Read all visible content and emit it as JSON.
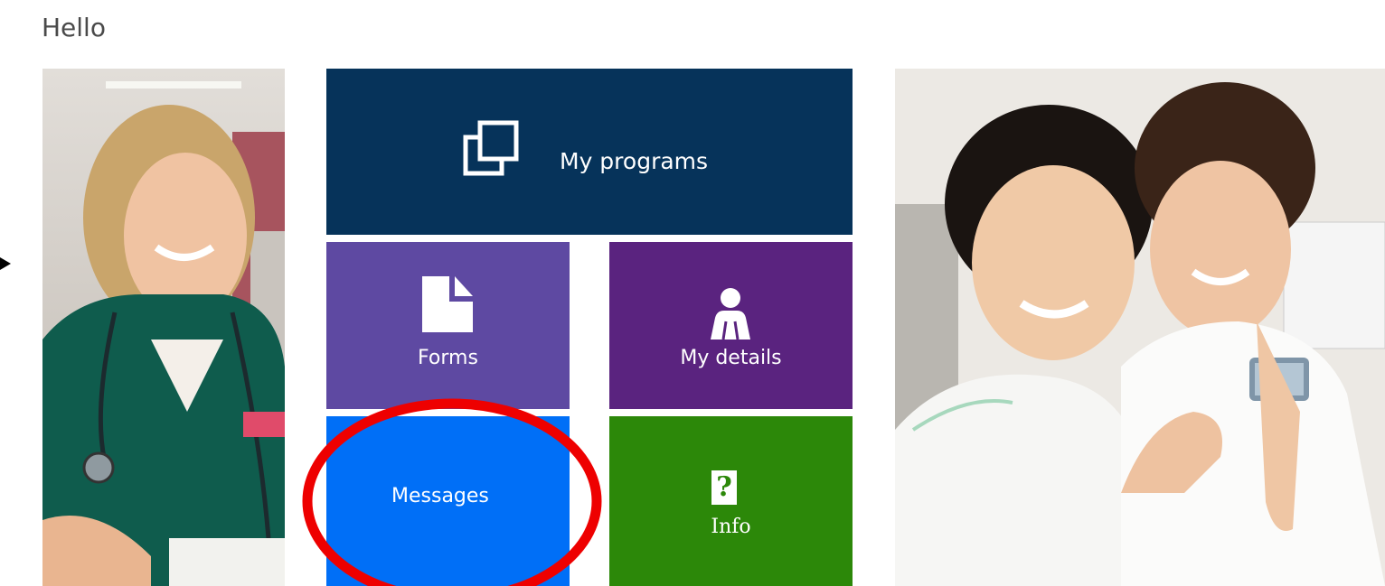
{
  "header": {
    "greeting": "Hello"
  },
  "tiles": {
    "programs": {
      "label": "My programs",
      "icon": "copy-squares-icon",
      "color": "#06335a"
    },
    "forms": {
      "label": "Forms",
      "icon": "document-icon",
      "color": "#5e49a2"
    },
    "details": {
      "label": "My details",
      "icon": "person-icon",
      "color": "#5a237f"
    },
    "messages": {
      "label": "Messages",
      "color": "#006ff7"
    },
    "info": {
      "label": "Info",
      "icon_glyph": "?",
      "icon": "question-mark-icon",
      "color": "#2c8809"
    }
  },
  "annotation": {
    "color": "#ee0000"
  },
  "images": {
    "left": "nurse-photo",
    "right": "dental-staff-photo"
  }
}
